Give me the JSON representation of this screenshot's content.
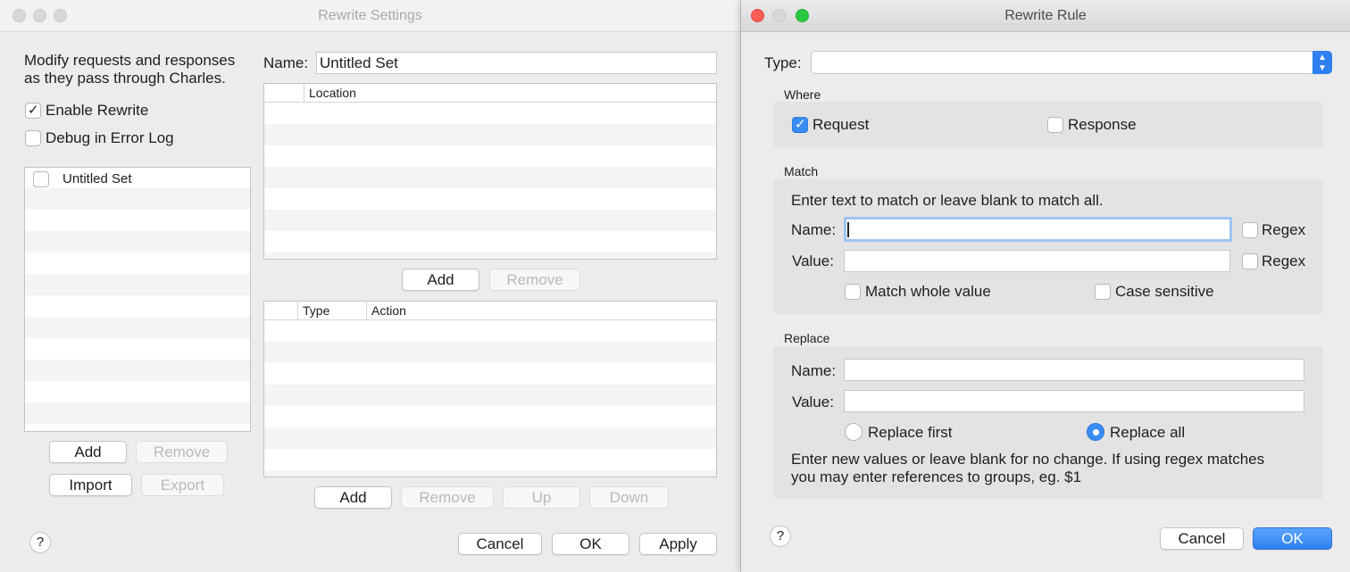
{
  "settings": {
    "title": "Rewrite Settings",
    "description_line1": "Modify requests and responses",
    "description_line2": "as they pass through Charles.",
    "enable_label": "Enable Rewrite",
    "debug_label": "Debug in Error Log",
    "sets": [
      {
        "name": "Untitled Set",
        "checked": false
      }
    ],
    "add": "Add",
    "remove": "Remove",
    "import": "Import",
    "export": "Export",
    "name_label": "Name:",
    "name_value": "Untitled Set",
    "location_header": "Location",
    "rules_headers": {
      "type": "Type",
      "action": "Action"
    },
    "up": "Up",
    "down": "Down",
    "cancel": "Cancel",
    "ok": "OK",
    "apply": "Apply",
    "help": "?"
  },
  "rule": {
    "title": "Rewrite Rule",
    "type_label": "Type:",
    "type_value": "",
    "where_label": "Where",
    "request_label": "Request",
    "request_checked": true,
    "response_label": "Response",
    "response_checked": false,
    "match_label": "Match",
    "match_hint": "Enter text to match or leave blank to match all.",
    "name_label": "Name:",
    "value_label": "Value:",
    "match_name_value": "",
    "match_value_value": "",
    "regex_label": "Regex",
    "match_whole_label": "Match whole value",
    "case_sensitive_label": "Case sensitive",
    "replace_label": "Replace",
    "replace_name_value": "",
    "replace_value_value": "",
    "replace_first_label": "Replace first",
    "replace_all_label": "Replace all",
    "replace_mode": "all",
    "replace_hint_line1": "Enter new values or leave blank for no change. If using regex matches",
    "replace_hint_line2": "you may enter references to groups, eg. $1",
    "cancel": "Cancel",
    "ok": "OK",
    "help": "?"
  },
  "colors": {
    "accent": "#3a8cf5",
    "close": "#fc5f57",
    "minimize": "#fdbb2e",
    "zoom": "#29c840"
  }
}
